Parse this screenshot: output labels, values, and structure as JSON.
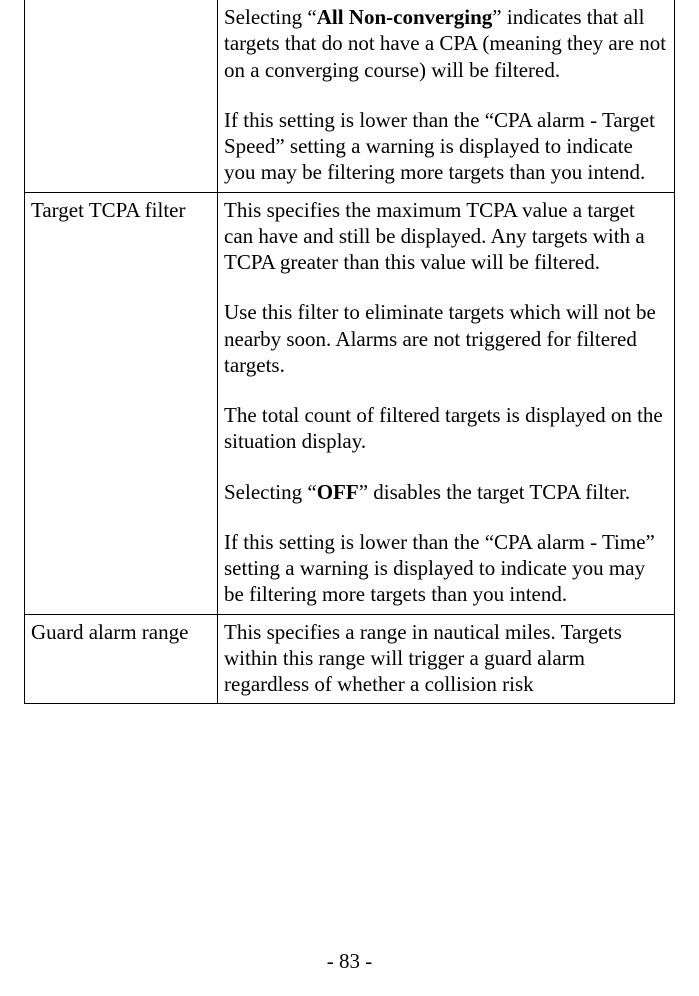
{
  "page_number": "- 83 -",
  "rows": [
    {
      "label": "",
      "paras": [
        {
          "pre": "Selecting “",
          "bold": "All Non-converging",
          "post": "” indicates that all targets that do not have a CPA (meaning they are not on a converging course) will be filtered."
        },
        {
          "pre": "If this setting is lower than the “CPA alarm - Target Speed” setting a warning is displayed to indicate you may be filtering more targets than you intend.",
          "bold": "",
          "post": ""
        }
      ]
    },
    {
      "label": "Target TCPA filter",
      "paras": [
        {
          "pre": "This specifies the maximum TCPA value a target can have and still be displayed. Any targets with a TCPA greater than this value will be filtered.",
          "bold": "",
          "post": ""
        },
        {
          "pre": "Use this filter to eliminate targets which will not be nearby soon. Alarms are not triggered for filtered targets.",
          "bold": "",
          "post": ""
        },
        {
          "pre": "The total count of filtered targets is displayed on the situation display.",
          "bold": "",
          "post": ""
        },
        {
          "pre": "Selecting “",
          "bold": "OFF",
          "post": "” disables the target TCPA filter."
        },
        {
          "pre": "If this setting is lower than the “CPA alarm - Time” setting a warning is displayed to indicate you may be filtering more targets than you intend.",
          "bold": "",
          "post": ""
        }
      ]
    },
    {
      "label": "Guard alarm range",
      "paras": [
        {
          "pre": "This specifies a range in nautical miles. Targets within this range will trigger a guard alarm regardless of whether a collision risk",
          "bold": "",
          "post": ""
        }
      ]
    }
  ]
}
